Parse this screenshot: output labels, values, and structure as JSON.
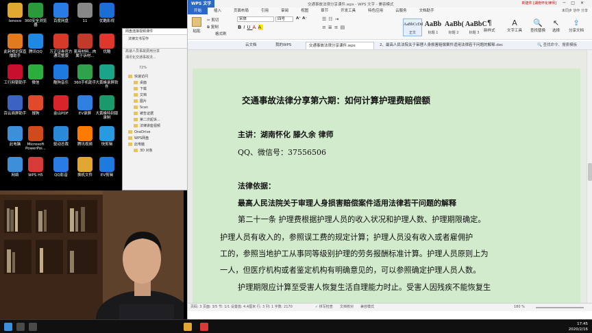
{
  "desktop_icons": [
    {
      "label": "lenovo",
      "icon": "folder-icon",
      "color": "#e0a830"
    },
    {
      "label": "360安全浏览器",
      "icon": "browser-360-icon",
      "color": "#2a9a3a"
    },
    {
      "label": "百度网盘",
      "icon": "baidu-netdisk-icon",
      "color": "#2a7be4"
    },
    {
      "label": "11",
      "icon": "film-icon",
      "color": "#888888"
    },
    {
      "label": "优酷影视",
      "icon": "youku-icon",
      "color": "#1b6ed6"
    },
    {
      "label": "此利哨识保直播助手",
      "icon": "live-assistant-icon",
      "color": "#e27b1d"
    },
    {
      "label": "腾讯QQ",
      "icon": "qq-icon",
      "color": "#1e88e5"
    },
    {
      "label": "万正证券官方通完整版",
      "icon": "securities-icon",
      "color": "#d83a2a"
    },
    {
      "label": "套用材料...肉属于诉材...",
      "icon": "document-icon",
      "color": "#c23a2a"
    },
    {
      "label": "优酷",
      "icon": "youku-play-icon",
      "color": "#e0362c"
    },
    {
      "label": "工行网银助手",
      "icon": "icbc-icon",
      "color": "#c8102e"
    },
    {
      "label": "微信",
      "icon": "wechat-icon",
      "color": "#2bae3d"
    },
    {
      "label": "酷狗音乐",
      "icon": "kugou-icon",
      "color": "#1f7ae0"
    },
    {
      "label": "360手机助手",
      "icon": "phone-assistant-icon",
      "color": "#2fa24b"
    },
    {
      "label": "大黄蜂录屏软件",
      "icon": "recorder-icon",
      "color": "#1aa58a"
    },
    {
      "label": "百云商屏助手",
      "icon": "screen-assistant-icon",
      "color": "#3a63c4"
    },
    {
      "label": "搜狗",
      "icon": "sogou-icon",
      "color": "#e04a2a"
    },
    {
      "label": "金山PDF",
      "icon": "pdf-icon",
      "color": "#d8242a"
    },
    {
      "label": "EV录屏",
      "icon": "ev-record-icon",
      "color": "#2f7fe0"
    },
    {
      "label": "大黄蜂特别版录制",
      "icon": "recorder-special-icon",
      "color": "#1a9a6a"
    },
    {
      "label": "此电脑",
      "icon": "computer-icon",
      "color": "#3c8fd8"
    },
    {
      "label": "Microsoft PowerPoi...",
      "icon": "powerpoint-icon",
      "color": "#d04a1e"
    },
    {
      "label": "驱动总裁",
      "icon": "driver-icon",
      "color": "#2a8ad8"
    },
    {
      "label": "腾讯视频",
      "icon": "tencent-video-icon",
      "color": "#ff7a00"
    },
    {
      "label": "快剪辑",
      "icon": "video-editor-icon",
      "color": "#2a9ae0"
    },
    {
      "label": "网络",
      "icon": "network-icon",
      "color": "#3c8fd8"
    },
    {
      "label": "WPS H5",
      "icon": "wps-h5-icon",
      "color": "#d83a3a"
    },
    {
      "label": "QQ影音",
      "icon": "qq-player-icon",
      "color": "#2a7be4"
    },
    {
      "label": "换机文件",
      "icon": "file-icon",
      "color": "#e0a830"
    },
    {
      "label": "EV剪辑",
      "icon": "ev-edit-icon",
      "color": "#1f7ae0"
    }
  ],
  "explorer": {
    "tab_title": "网盘连接视频课件",
    "zoom": "72%",
    "tree": [
      "快速访问",
      "桌面",
      "下载",
      "文档",
      "图片",
      "Scan",
      "被告证据",
      "第二次起诉...",
      "法律讲座视频",
      "OneDrive",
      "WPS网盘",
      "此电脑",
      "3D 对象"
    ],
    "crumbs": [
      "法律文书写作",
      "高速人员事故费用分享",
      "湘讯化交通事故法..."
    ]
  },
  "wps": {
    "app_label": "WPS 文字",
    "window_title": "交通事故法律分享课件.wps - WPS 文字 - 兼容模式",
    "user": "新建件 [湖南怀化律师]",
    "menus": [
      "开始",
      "插入",
      "页面布局",
      "引用",
      "审阅",
      "视图",
      "章节",
      "开发工具",
      "特色应用",
      "云服务",
      "文档助手"
    ],
    "active_menu": "开始",
    "menu_right": "未同步  协作  分享",
    "ribbon": {
      "paste": "粘贴",
      "cut": "剪切",
      "copy": "复制",
      "format_painter": "格式刷",
      "font_name": "宋体",
      "font_size": "四号",
      "styles": [
        {
          "preview": "AaBbCcDd",
          "label": "正文"
        },
        {
          "preview": "AaBb",
          "label": "标题 1"
        },
        {
          "preview": "AaBb(",
          "label": "标题 2"
        },
        {
          "preview": "AaBbC",
          "label": "标题 3"
        }
      ],
      "new_style": "新样式",
      "text_tools": "文字工具",
      "find_replace": "查找替换",
      "select": "选择",
      "share": "分享文档"
    },
    "doc_tabs": [
      "云文档",
      "我的WPS",
      "交通事故法律分享课件.wps",
      "2、最高人民法院关于审理人身损害赔偿案件适用法律若干问题的解释.doc"
    ],
    "active_doc_tab": 2,
    "search_placeholder": "查找命令、搜索模板",
    "document": {
      "title": "交通事故法律分享第六期：如何计算护理费赔偿额",
      "speaker": "主讲：湖南怀化   滕久余   律师",
      "qq": "QQ、微信号：37556506",
      "basis_heading": "法律依据：",
      "law_title": "最高人民法院关于审理人身损害赔偿案件适用法律若干问题的解释",
      "para_lines": [
        "第二十一条   护理费根据护理人员的收入状况和护理人数、护理期限确定。",
        "护理人员有收入的，参照误工费的规定计算；护理人员没有收入或者雇佣护",
        "工的，参照当地护工从事同等级别护理的劳务报酬标准计算。护理人员原则上为",
        "一人，但医疗机构或者鉴定机构有明确意见的，可以参照确定护理人员人数。",
        "护理期限应计算至受害人恢复生活自理能力时止。受害人因残疾不能恢复生"
      ]
    },
    "status": {
      "left": "页码: 3   页面: 3/5   节: 1/1   设置值: 4.4厘米   行: 3   列: 1   字数: 2170",
      "spell": "拼写检查",
      "protect": "文档校对",
      "mode": "兼容模式",
      "zoom": "180 %"
    }
  },
  "taskbar": {
    "time": "17:45",
    "date": "2020/2/16"
  }
}
